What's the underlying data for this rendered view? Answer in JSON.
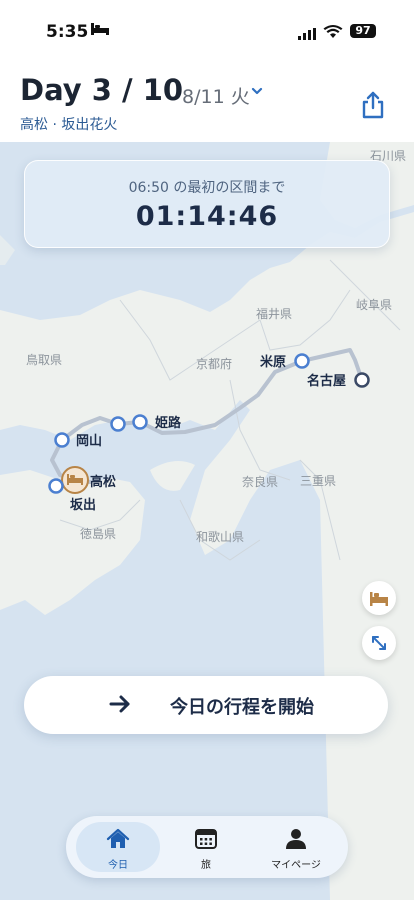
{
  "status_bar": {
    "time": "5:35",
    "battery": "97"
  },
  "header": {
    "day_title": "Day 3 / 10",
    "date": "8/11 火",
    "subtitle": "高松 · 坂出花火"
  },
  "countdown": {
    "label": "06:50 の最初の区間まで",
    "timer": "01:14:46"
  },
  "map": {
    "stations": [
      {
        "name": "名古屋"
      },
      {
        "name": "米原"
      },
      {
        "name": "姫路"
      },
      {
        "name": "岡山"
      },
      {
        "name": "高松"
      },
      {
        "name": "坂出"
      }
    ],
    "regions": [
      "福井県",
      "岐阜県",
      "鳥取県",
      "京都府",
      "奈良県",
      "三重県",
      "徳島県",
      "和歌山県",
      "石川県"
    ]
  },
  "start_button": {
    "label": "今日の行程を開始"
  },
  "tabs": [
    {
      "label": "今日",
      "icon": "home-icon",
      "active": true
    },
    {
      "label": "旅",
      "icon": "calendar-icon",
      "active": false
    },
    {
      "label": "マイページ",
      "icon": "person-icon",
      "active": false
    }
  ],
  "colors": {
    "accent": "#2f6fc0",
    "route_line": "#b8c2d0",
    "hotel": "#b88446",
    "dark_text": "#1d2c48"
  }
}
